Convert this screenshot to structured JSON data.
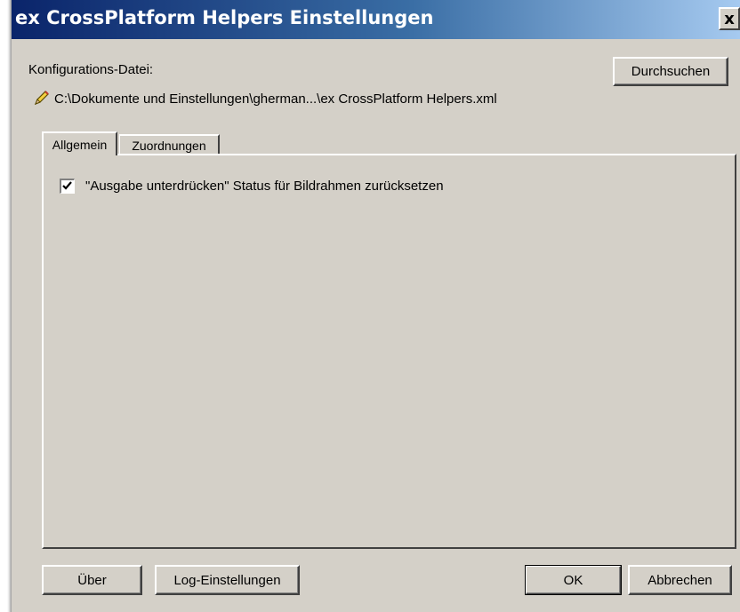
{
  "window": {
    "title": "ex CrossPlatform Helpers Einstellungen",
    "close_label": "x"
  },
  "config": {
    "label": "Konfigurations-Datei:",
    "path": "C:\\Dokumente und Einstellungen\\gherman...\\ex CrossPlatform Helpers.xml",
    "browse_label": "Durchsuchen",
    "path_icon": "pencil-icon"
  },
  "tabs": [
    {
      "label": "Allgemein",
      "active": true
    },
    {
      "label": "Zuordnungen",
      "active": false
    }
  ],
  "general": {
    "checkbox_label": "\"Ausgabe unterdrücken\" Status für Bildrahmen zurücksetzen",
    "checkbox_checked": true
  },
  "footer": {
    "about_label": "Über",
    "log_settings_label": "Log-Einstellungen",
    "ok_label": "OK",
    "cancel_label": "Abbrechen"
  },
  "colors": {
    "titlebar_start": "#0a246a",
    "titlebar_end": "#a6caf0",
    "face": "#d4d0c8"
  }
}
